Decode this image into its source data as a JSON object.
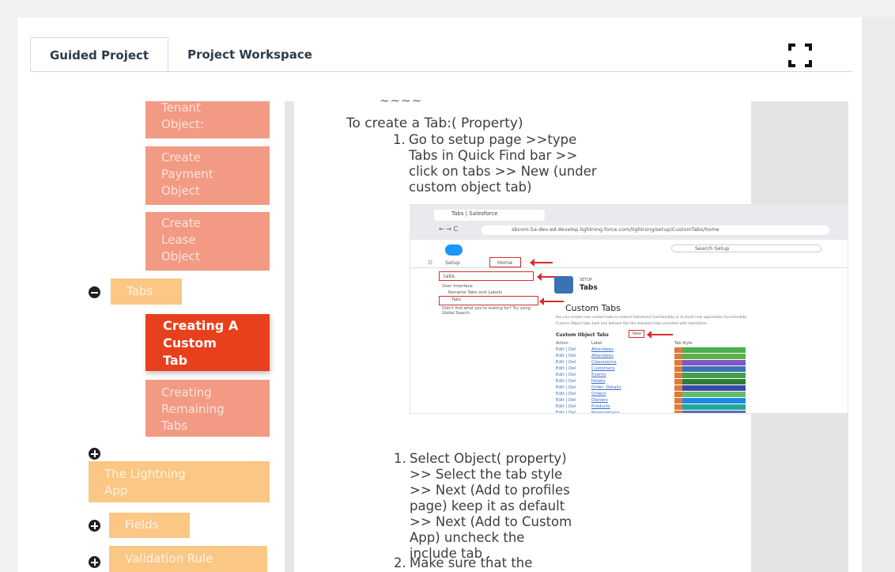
{
  "tabs": [
    {
      "label": "Guided Project",
      "active": true
    },
    {
      "label": "Project Workspace",
      "active": false
    }
  ],
  "fullscreen_icon": "fullscreen-icon",
  "sidebar": {
    "tenant_object": "Tenant\nObject:",
    "create_payment": "Create\nPayment\nObject",
    "create_lease": "Create\nLease\nObject",
    "tabs_section": "Tabs",
    "creating_custom_tab": "Creating A\nCustom\nTab",
    "creating_remaining_tabs": "Creating\nRemaining\nTabs",
    "lightning_app": "The Lightning\nApp",
    "fields": "Fields",
    "validation_rule": "Validation Rule"
  },
  "content": {
    "intro": "To create a Tab:( Property)",
    "step1_num": "1.",
    "step1_text": "Go to setup page >>type\nTabs in Quick Find bar >>\nclick on tabs >> New (under\ncustom object tab)",
    "step2_num": "1.",
    "step2_text": "Select Object( property)\n>> Select the tab style\n>> Next (Add to profiles\npage) keep it as default\n>> Next (Add to Custom\nApp)  uncheck the\ninclude tab .",
    "step3_num": "2.",
    "step3_text": "Make sure that the"
  },
  "embedded_screenshot": {
    "browser_tab": "Tabs | Salesforce",
    "url": "sbcom-5a-dev-ed.develop.lightning.force.com/lightning/setup/CustomTabs/home",
    "nav_setup": "Setup",
    "nav_home": "Home",
    "search_label": "Search Setup",
    "quick_find": "tabs",
    "user_interface": "User Interface",
    "rename": "Rename Tabs and Labels",
    "tabs_item": "Tabs",
    "not_find": "Didn't find what you're looking for? Try using Global Search.",
    "setup_small": "SETUP",
    "header": "Tabs",
    "custom_tabs": "Custom Tabs",
    "cot": "Custom Object Tabs",
    "new_button": "New",
    "action_col": "Action",
    "label_col": "Label",
    "style_col": "Tab Style",
    "rows": [
      {
        "action": "Edit | Del",
        "label": "Attendees"
      },
      {
        "action": "Edit | Del",
        "label": "Attendees"
      },
      {
        "action": "Edit | Del",
        "label": "Classrooms"
      },
      {
        "action": "Edit | Del",
        "label": "Customers"
      },
      {
        "action": "Edit | Del",
        "label": "Events"
      },
      {
        "action": "Edit | Del",
        "label": "Hotels"
      },
      {
        "action": "Edit | Del",
        "label": "Order_Details"
      },
      {
        "action": "Edit | Del",
        "label": "Orders"
      },
      {
        "action": "Edit | Del",
        "label": "Owners"
      },
      {
        "action": "Edit | Del",
        "label": "Products"
      },
      {
        "action": "Edit | Del",
        "label": "Reservations"
      },
      {
        "action": "Edit | Del",
        "label": "Rooms"
      },
      {
        "action": "Edit | Del",
        "label": "Sessions"
      }
    ]
  },
  "colors": {
    "salmon": "#f29a84",
    "active": "#e8401c",
    "peach": "#fbc784"
  }
}
